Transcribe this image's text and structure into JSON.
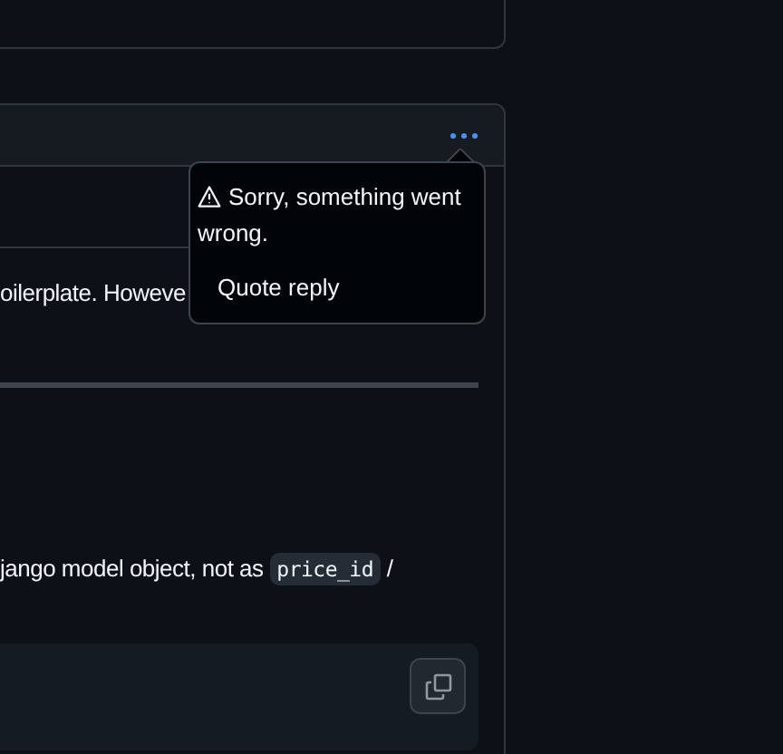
{
  "comment": {
    "popover": {
      "error": "Sorry, something went wrong.",
      "items": [
        "Quote reply"
      ]
    },
    "body": {
      "paragraph_1": "oilerplate. Howeve",
      "paragraph_2": {
        "text": "jango model object, not as ",
        "code": "price_id",
        "after": " /"
      }
    }
  }
}
